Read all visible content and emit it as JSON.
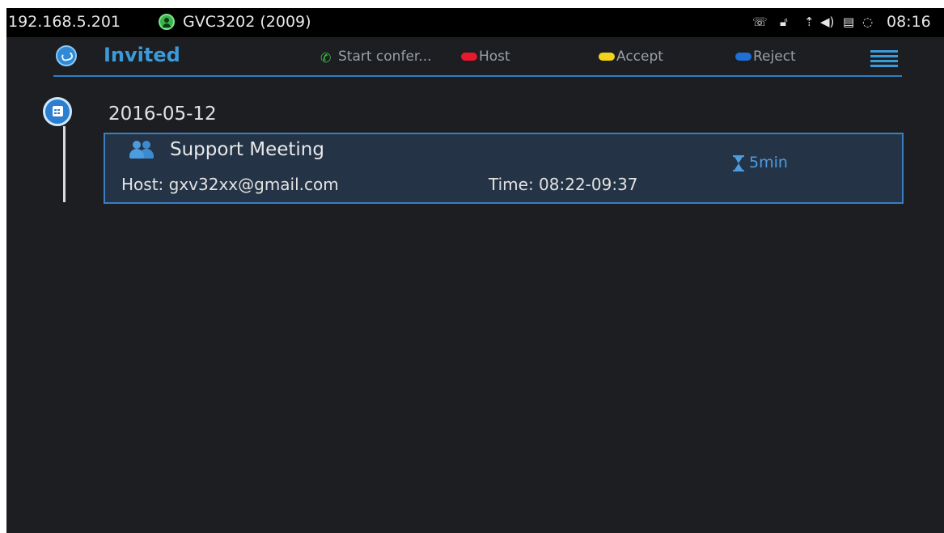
{
  "status_bar": {
    "ip": "192.168.5.201",
    "account_label": "GVC3202 (2009)",
    "time": "08:16",
    "icons": [
      "call-forward-icon",
      "lock-icon",
      "upload-icon",
      "volume-icon",
      "sd-card-icon",
      "sync-icon"
    ]
  },
  "header": {
    "title": "Invited",
    "legend": [
      {
        "label": "Start confer...",
        "icon": "phone-icon",
        "color": "#3fbf3f"
      },
      {
        "label": "Host",
        "icon": "dot",
        "color": "#e8192c"
      },
      {
        "label": "Accept",
        "icon": "dot",
        "color": "#f2d21b"
      },
      {
        "label": "Reject",
        "icon": "dot",
        "color": "#1f6fd6"
      }
    ],
    "menu_icon": "menu-icon"
  },
  "timeline": {
    "date": "2016-05-12",
    "meeting": {
      "title": "Support Meeting",
      "host": "Host: gxv32xx@gmail.com",
      "time": "Time: 08:22-09:37",
      "duration": "5min"
    }
  },
  "colors": {
    "accent": "#3d9ad9",
    "card_bg": "#243446",
    "card_border": "#3a7fc2",
    "background": "#1c1e22"
  }
}
